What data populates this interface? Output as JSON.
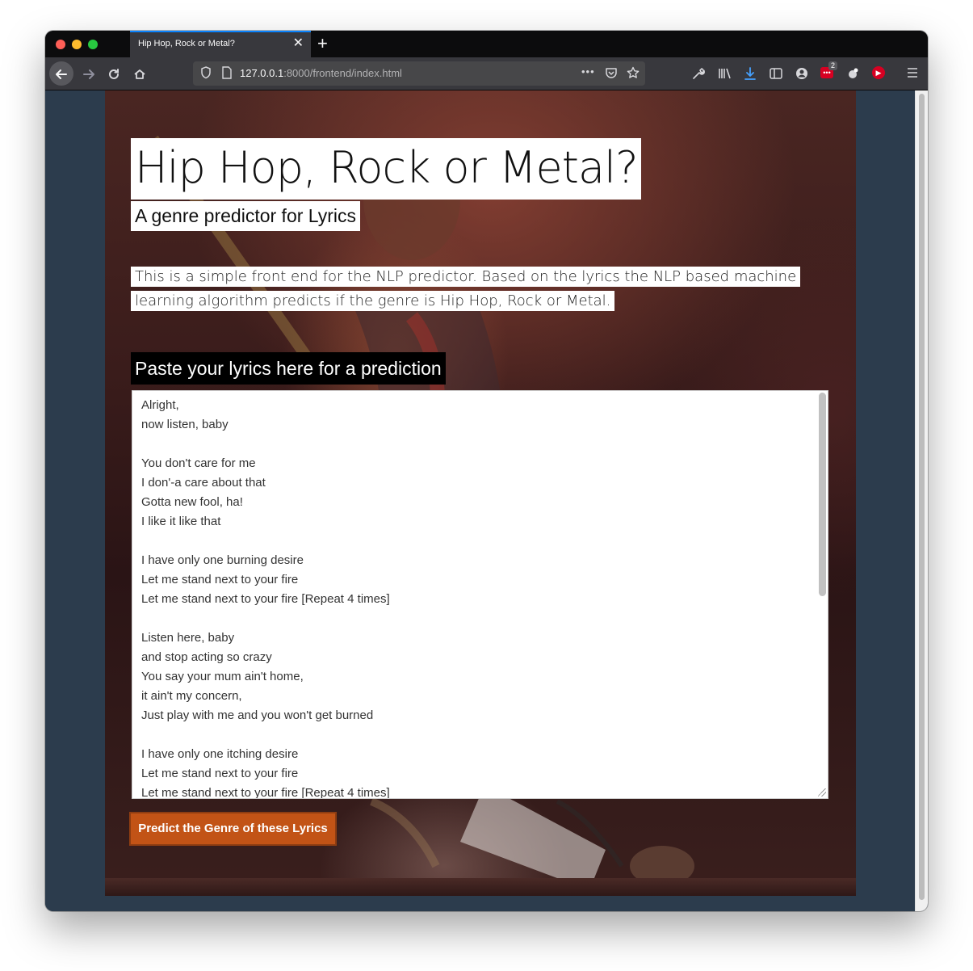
{
  "browser": {
    "tab_title": "Hip Hop, Rock or Metal?",
    "tab_close": "✕",
    "new_tab": "+",
    "url_host": "127.0.0.1",
    "url_rest": ":8000/frontend/index.html",
    "more_actions": "•••",
    "extension_badge_count": "2"
  },
  "page": {
    "title": "Hip Hop, Rock or Metal?",
    "subtitle": "A genre predictor for Lyrics",
    "description": "This is a simple front end for the NLP predictor. Based on the lyrics the NLP based machine learning algorithm predicts if the genre is Hip Hop, Rock or Metal.",
    "prompt": "Paste your lyrics here for a prediction",
    "lyrics": "Alright,\nnow listen, baby\n\nYou don't care for me\nI don'-a care about that\nGotta new fool, ha!\nI like it like that\n\nI have only one burning desire\nLet me stand next to your fire\nLet me stand next to your fire [Repeat 4 times]\n\nListen here, baby\nand stop acting so crazy\nYou say your mum ain't home,\nit ain't my concern,\nJust play with me and you won't get burned\n\nI have only one itching desire\nLet me stand next to your fire\nLet me stand next to your fire [Repeat 4 times]",
    "predict_button": "Predict the Genre of these Lyrics"
  },
  "colors": {
    "accent_button": "#c25316",
    "page_background": "#2c3c4d",
    "tab_highlight": "#0a84ff"
  }
}
